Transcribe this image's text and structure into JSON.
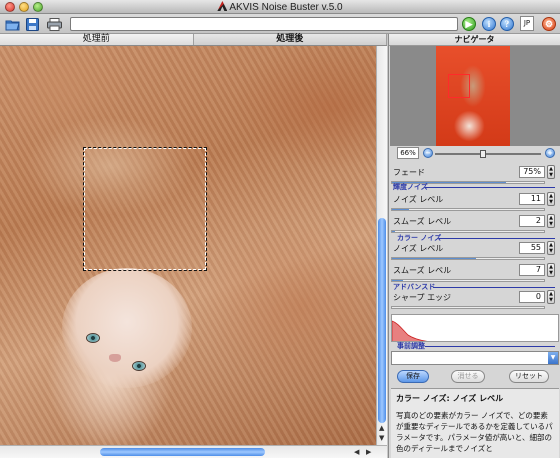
{
  "window": {
    "title": "AKVIS Noise Buster v.5.0"
  },
  "toolbar": {
    "lang": "JP"
  },
  "tabs": [
    {
      "label": "処理前"
    },
    {
      "label": "処理後"
    }
  ],
  "navigator": {
    "title": "ナビゲータ",
    "zoom": "66%",
    "zoom_minus": "−",
    "zoom_plus": "+"
  },
  "settings": {
    "fade": {
      "label": "フェード",
      "value": "75%",
      "fill_fraction": 0.75
    },
    "luminance_group": "輝度ノイズ",
    "lum_noise": {
      "label": "ノイズ レベル",
      "value": "11",
      "fill_fraction": 0.11
    },
    "lum_smooth": {
      "label": "スムーズ レベル",
      "value": "2",
      "fill_fraction": 0.02
    },
    "color_group": "カラー ノイズ",
    "color_noise": {
      "label": "ノイズ レベル",
      "value": "55",
      "fill_fraction": 0.55
    },
    "color_smooth": {
      "label": "スムーズ レベル",
      "value": "7",
      "fill_fraction": 0.07
    },
    "advanced_group": "アドバンスド",
    "sharp_edges": {
      "label": "シャープ エッジ",
      "value": "0",
      "fill_fraction": 0
    }
  },
  "presets": {
    "header": "事前調整",
    "save": "保存",
    "delete": "消せる",
    "reset": "リセット"
  },
  "help": {
    "title": "カラー ノイズ: ノイズ レベル",
    "body": "写真のどの要素がカラー ノイズで、どの要素が重要なディテールであるかを定義しているパラメータです。パラメータ値が高いと、細部の色のディテールまでノイズと"
  }
}
